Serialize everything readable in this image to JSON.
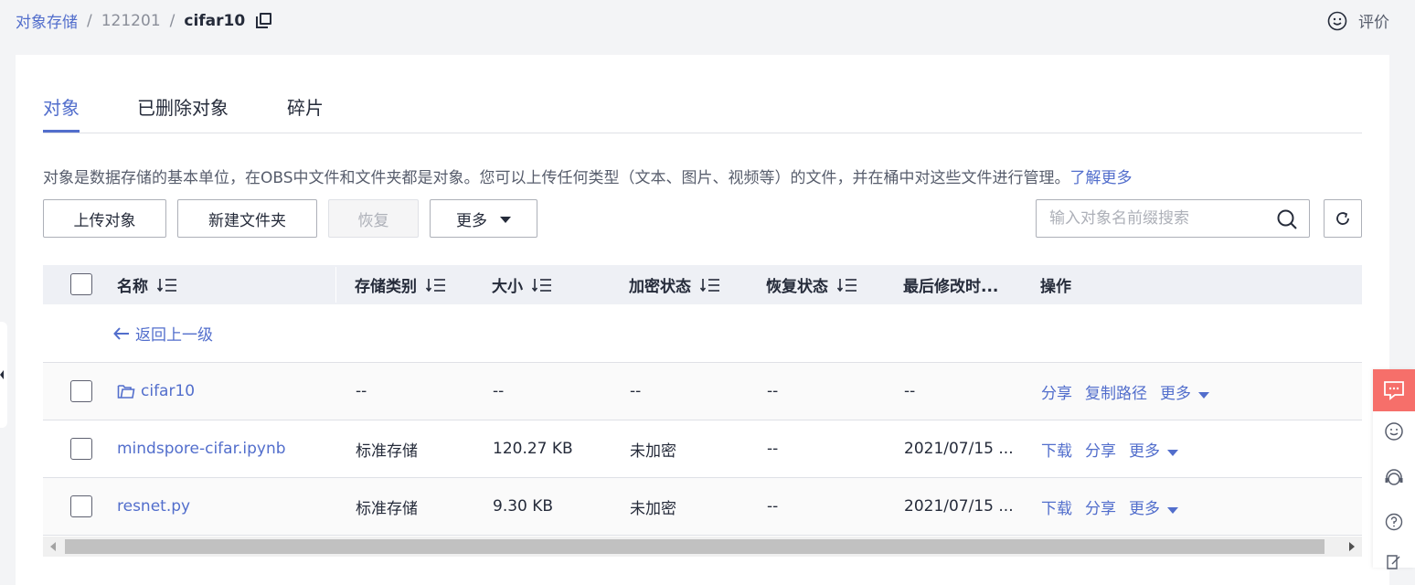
{
  "breadcrumb": {
    "root": "对象存储",
    "parent": "121201",
    "current": "cifar10"
  },
  "rate_label": "评价",
  "tabs": [
    {
      "label": "对象",
      "active": true
    },
    {
      "label": "已删除对象",
      "active": false
    },
    {
      "label": "碎片",
      "active": false
    }
  ],
  "description": {
    "text": "对象是数据存储的基本单位，在OBS中文件和文件夹都是对象。您可以上传任何类型（文本、图片、视频等）的文件，并在桶中对这些文件进行管理。",
    "link": "了解更多"
  },
  "toolbar": {
    "upload": "上传对象",
    "new_folder": "新建文件夹",
    "restore": "恢复",
    "more": "更多"
  },
  "search": {
    "placeholder": "输入对象名前缀搜索"
  },
  "table": {
    "headers": {
      "name": "名称",
      "storage": "存储类别",
      "size": "大小",
      "encrypt": "加密状态",
      "restore": "恢复状态",
      "modified": "最后修改时...",
      "ops": "操作"
    },
    "back_label": "返回上一级",
    "rows": [
      {
        "name": "cifar10",
        "storage": "--",
        "size": "--",
        "encrypt": "--",
        "restore": "--",
        "modified": "--",
        "op1": "分享",
        "op2": "复制路径",
        "op3": "更多"
      },
      {
        "name": "mindspore-cifar.ipynb",
        "storage": "标准存储",
        "size": "120.27 KB",
        "encrypt": "未加密",
        "restore": "--",
        "modified": "2021/07/15 ...",
        "op1": "下载",
        "op2": "分享",
        "op3": "更多"
      },
      {
        "name": "resnet.py",
        "storage": "标准存储",
        "size": "9.30 KB",
        "encrypt": "未加密",
        "restore": "--",
        "modified": "2021/07/15 ...",
        "op1": "下载",
        "op2": "分享",
        "op3": "更多"
      }
    ]
  },
  "colors": {
    "accent": "#526ecc",
    "chat_bg": "#f66f6a"
  }
}
